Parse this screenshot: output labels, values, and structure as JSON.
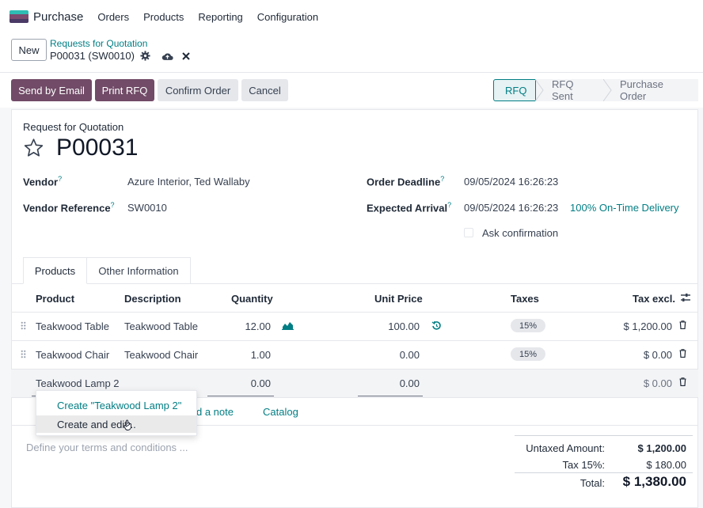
{
  "nav": {
    "app_name": "Purchase",
    "items": [
      "Orders",
      "Products",
      "Reporting",
      "Configuration"
    ],
    "logo_colors": [
      "#2ebcb4",
      "#7c4a6e",
      "#4a3a66"
    ]
  },
  "control_panel": {
    "new_label": "New",
    "breadcrumb": "Requests for Quotation",
    "record": "P00031 (SW0010)",
    "gear_icon": "gear-icon",
    "save_icon": "cloud-upload-icon",
    "discard_icon": "close-icon"
  },
  "actions": {
    "send_email": "Send by Email",
    "print_rfq": "Print RFQ",
    "confirm_order": "Confirm Order",
    "cancel": "Cancel"
  },
  "status_steps": [
    "RFQ",
    "RFQ Sent",
    "Purchase Order"
  ],
  "form": {
    "doc_type": "Request for Quotation",
    "name": "P00031",
    "vendor_label": "Vendor",
    "vendor_value": "Azure Interior, Ted Wallaby",
    "vendor_ref_label": "Vendor Reference",
    "vendor_ref_value": "SW0010",
    "deadline_label": "Order Deadline",
    "deadline_value": "09/05/2024 16:26:23",
    "arrival_label": "Expected Arrival",
    "arrival_value": "09/05/2024 16:26:23",
    "on_time": "100% On-Time Delivery",
    "ask_confirmation": "Ask confirmation",
    "help_mark": "?"
  },
  "tabs": [
    "Products",
    "Other Information"
  ],
  "table": {
    "headers": [
      "Product",
      "Description",
      "Quantity",
      "Unit Price",
      "Taxes",
      "Tax excl."
    ],
    "rows": [
      {
        "product": "Teakwood Table",
        "description": "Teakwood Table",
        "quantity": "12.00",
        "unit_price": "100.00",
        "tax": "15%",
        "subtotal": "$ 1,200.00"
      },
      {
        "product": "Teakwood Chair",
        "description": "Teakwood Chair",
        "quantity": "1.00",
        "unit_price": "0.00",
        "tax": "15%",
        "subtotal": "$ 0.00"
      },
      {
        "product": "Teakwood Lamp 2",
        "description": "",
        "quantity": "0.00",
        "unit_price": "0.00",
        "tax": "",
        "subtotal": "$ 0.00"
      }
    ],
    "add_note": "d a note",
    "catalog": "Catalog"
  },
  "autocomplete": {
    "create": "Create \"Teakwood Lamp 2\"",
    "create_edit": "Create and edit..."
  },
  "terms_placeholder": "Define your terms and conditions ...",
  "totals": {
    "untaxed_label": "Untaxed Amount:",
    "untaxed_value": "$ 1,200.00",
    "tax_label": "Tax 15%:",
    "tax_value": "$ 180.00",
    "total_label": "Total:",
    "total_value": "$ 1,380.00"
  },
  "colors": {
    "primary": "#714b67",
    "accent": "#017e84"
  }
}
